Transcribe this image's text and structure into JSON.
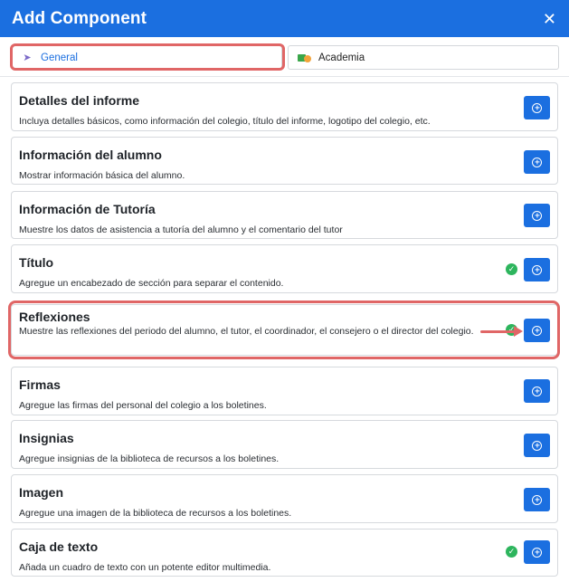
{
  "dialog": {
    "title": "Add Component",
    "close_icon": "✕"
  },
  "tabs": [
    {
      "label": "General",
      "icon": "rocket-icon",
      "active": true
    },
    {
      "label": "Academia",
      "icon": "academia-icon",
      "active": false
    }
  ],
  "components": [
    {
      "title": "Detalles del informe",
      "description": "Incluya detalles básicos, como información del colegio, título del informe, logotipo del colegio, etc.",
      "added": false
    },
    {
      "title": "Información del alumno",
      "description": "Mostrar información básica del alumno.",
      "added": false
    },
    {
      "title": "Información de Tutoría",
      "description": "Muestre los datos de asistencia a tutoría del alumno y el comentario del tutor",
      "added": false
    },
    {
      "title": "Título",
      "description": "Agregue un encabezado de sección para separar el contenido.",
      "added": true
    },
    {
      "title": "Reflexiones",
      "description": "Muestre las reflexiones del periodo del alumno, el tutor, el coordinador, el consejero o el director del colegio.",
      "added": true
    },
    {
      "title": "Firmas",
      "description": "Agregue las firmas del personal del colegio a los boletines.",
      "added": false
    },
    {
      "title": "Insignias",
      "description": "Agregue insignias de la biblioteca de recursos a los boletines.",
      "added": false
    },
    {
      "title": "Imagen",
      "description": "Agregue una imagen de la biblioteca de recursos a los boletines.",
      "added": false
    },
    {
      "title": "Caja de texto",
      "description": "Añada un cuadro de texto con un potente editor multimedia.",
      "added": true
    }
  ],
  "colors": {
    "brand": "#1b6fe0",
    "annotation": "#e06666",
    "added_check": "#2db55d"
  }
}
